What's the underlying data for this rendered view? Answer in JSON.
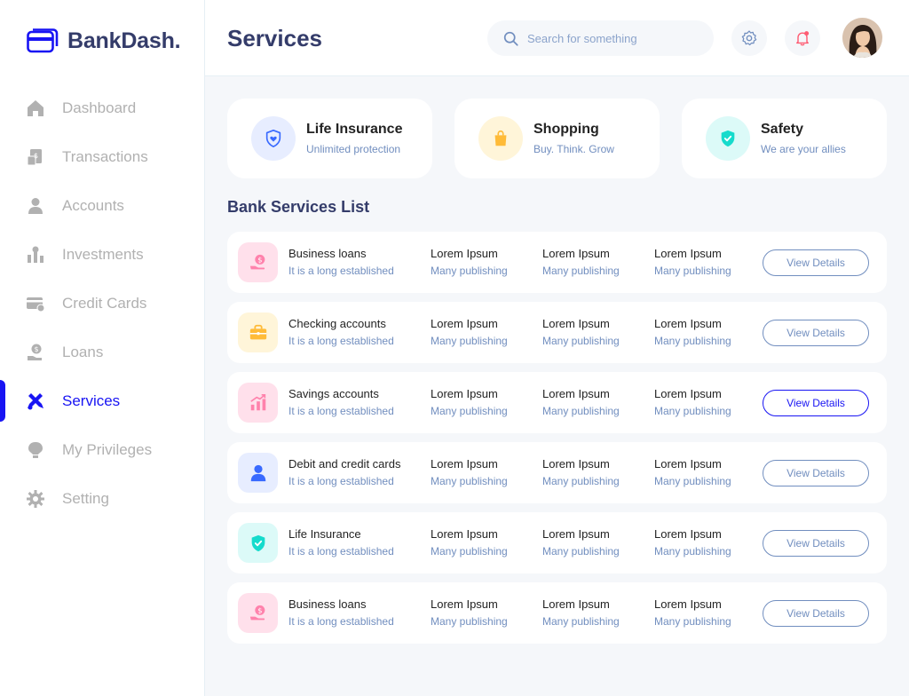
{
  "brand": {
    "name": "BankDash."
  },
  "sidebar": {
    "items": [
      {
        "label": "Dashboard",
        "icon": "home-icon",
        "active": false
      },
      {
        "label": "Transactions",
        "icon": "transfer-icon",
        "active": false
      },
      {
        "label": "Accounts",
        "icon": "user-icon",
        "active": false
      },
      {
        "label": "Investments",
        "icon": "investment-icon",
        "active": false
      },
      {
        "label": "Credit Cards",
        "icon": "credit-card-icon",
        "active": false
      },
      {
        "label": "Loans",
        "icon": "loan-icon",
        "active": false
      },
      {
        "label": "Services",
        "icon": "service-icon",
        "active": true
      },
      {
        "label": "My Privileges",
        "icon": "privilege-icon",
        "active": false
      },
      {
        "label": "Setting",
        "icon": "gear-icon",
        "active": false
      }
    ]
  },
  "header": {
    "title": "Services",
    "search_placeholder": "Search for something"
  },
  "cards": [
    {
      "title": "Life Insurance",
      "subtitle": "Unlimited protection",
      "icon": "shield-heart-icon",
      "bg": "#E7EDFF",
      "fg": "#396AFF"
    },
    {
      "title": "Shopping",
      "subtitle": "Buy. Think. Grow",
      "icon": "shopping-bag-icon",
      "bg": "#FFF5D9",
      "fg": "#FFBB38"
    },
    {
      "title": "Safety",
      "subtitle": "We are your allies",
      "icon": "shield-check-icon",
      "bg": "#DCFAF8",
      "fg": "#16DBCC"
    }
  ],
  "list_title": "Bank Services List",
  "services": [
    {
      "name": "Business loans",
      "desc": "It is a long established",
      "icon": "loan-hand-icon",
      "bg": "#FFE0EB",
      "fg": "#FF82AC",
      "cols": [
        {
          "title": "Lorem Ipsum",
          "sub": "Many publishing"
        },
        {
          "title": "Lorem Ipsum",
          "sub": "Many publishing"
        },
        {
          "title": "Lorem Ipsum",
          "sub": "Many publishing"
        }
      ],
      "button": "View Details",
      "active": false
    },
    {
      "name": "Checking accounts",
      "desc": "It is a long established",
      "icon": "briefcase-icon",
      "bg": "#FFF5D9",
      "fg": "#FFBB38",
      "cols": [
        {
          "title": "Lorem Ipsum",
          "sub": "Many publishing"
        },
        {
          "title": "Lorem Ipsum",
          "sub": "Many publishing"
        },
        {
          "title": "Lorem Ipsum",
          "sub": "Many publishing"
        }
      ],
      "button": "View Details",
      "active": false
    },
    {
      "name": "Savings accounts",
      "desc": "It is a long established",
      "icon": "chart-up-icon",
      "bg": "#FFE0EB",
      "fg": "#FF82AC",
      "cols": [
        {
          "title": "Lorem Ipsum",
          "sub": "Many publishing"
        },
        {
          "title": "Lorem Ipsum",
          "sub": "Many publishing"
        },
        {
          "title": "Lorem Ipsum",
          "sub": "Many publishing"
        }
      ],
      "button": "View Details",
      "active": true
    },
    {
      "name": "Debit and credit cards",
      "desc": "It is a long established",
      "icon": "user-icon",
      "bg": "#E7EDFF",
      "fg": "#396AFF",
      "cols": [
        {
          "title": "Lorem Ipsum",
          "sub": "Many publishing"
        },
        {
          "title": "Lorem Ipsum",
          "sub": "Many publishing"
        },
        {
          "title": "Lorem Ipsum",
          "sub": "Many publishing"
        }
      ],
      "button": "View Details",
      "active": false
    },
    {
      "name": "Life Insurance",
      "desc": "It is a long established",
      "icon": "shield-check-icon",
      "bg": "#DCFAF8",
      "fg": "#16DBCC",
      "cols": [
        {
          "title": "Lorem Ipsum",
          "sub": "Many publishing"
        },
        {
          "title": "Lorem Ipsum",
          "sub": "Many publishing"
        },
        {
          "title": "Lorem Ipsum",
          "sub": "Many publishing"
        }
      ],
      "button": "View Details",
      "active": false
    },
    {
      "name": "Business loans",
      "desc": "It is a long established",
      "icon": "loan-hand-icon",
      "bg": "#FFE0EB",
      "fg": "#FF82AC",
      "cols": [
        {
          "title": "Lorem Ipsum",
          "sub": "Many publishing"
        },
        {
          "title": "Lorem Ipsum",
          "sub": "Many publishing"
        },
        {
          "title": "Lorem Ipsum",
          "sub": "Many publishing"
        }
      ],
      "button": "View Details",
      "active": false
    }
  ],
  "colors": {
    "accent": "#1814F3",
    "title": "#343C6A",
    "muted": "#718EBF",
    "nav_inactive": "#B1B1B1"
  }
}
